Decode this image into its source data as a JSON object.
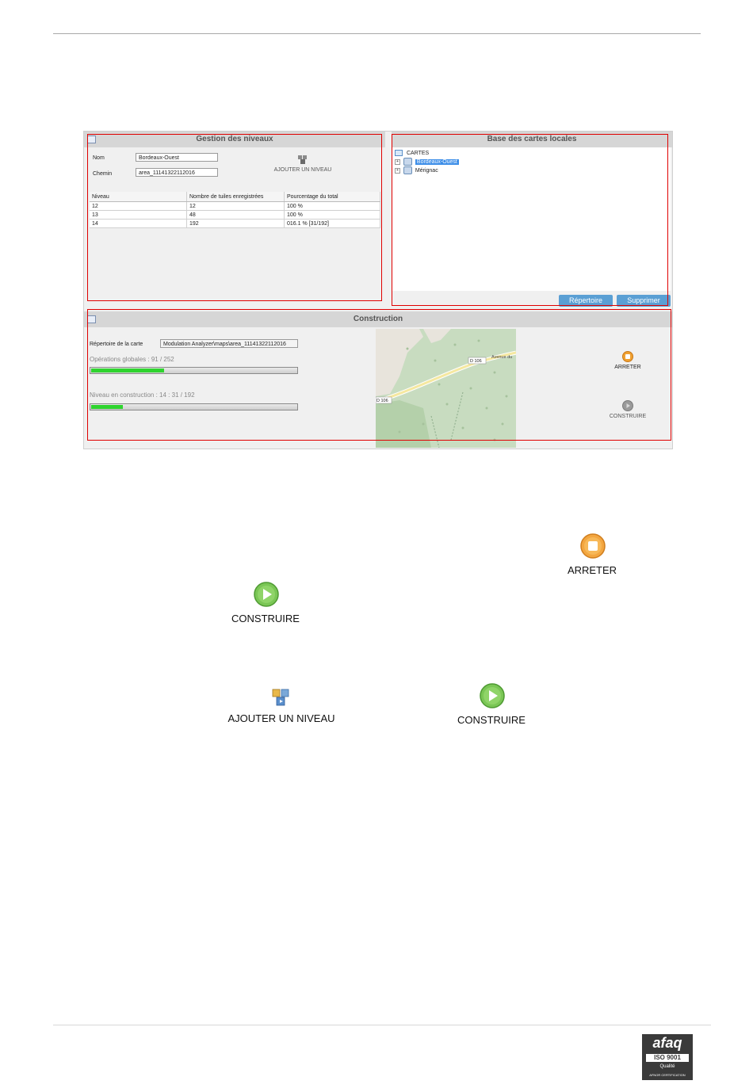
{
  "gestion": {
    "title": "Gestion des niveaux",
    "nom_label": "Nom",
    "nom_value": "Bordeaux-Ouest",
    "chemin_label": "Chemin",
    "chemin_value": "area_11141322112016",
    "add_level_label": "AJOUTER UN NIVEAU",
    "table": {
      "headers": [
        "Niveau",
        "Nombre de tuiles enregistrées",
        "Pourcentage du total"
      ],
      "rows": [
        [
          "12",
          "12",
          "100 %"
        ],
        [
          "13",
          "48",
          "100 %"
        ],
        [
          "14",
          "192",
          "016.1 %  [31/192]"
        ]
      ]
    }
  },
  "base": {
    "title": "Base des cartes locales",
    "root": "CARTES",
    "items": [
      "Bordeaux-Ouest",
      "Mérignac"
    ],
    "repertoire_button": "Répertoire",
    "supprimer_button": "Supprimer"
  },
  "construction": {
    "title": "Construction",
    "repertoire_label": "Répertoire de la carte",
    "repertoire_value": "Modulation Analyzer\\maps\\area_11141322112016",
    "ops_label": "Opérations globales : 91 / 252",
    "ops_progress": 0.361,
    "niveau_label": "Niveau en construction : 14 : 31 / 192",
    "niveau_progress": 0.161,
    "map_labels": [
      "D 106",
      "Avenue du",
      "D 106"
    ],
    "arreter_label": "ARRETER",
    "construire_label": "CONSTRUIRE"
  },
  "icons": {
    "arreter_label": "ARRETER",
    "construire_label_1": "CONSTRUIRE",
    "ajouter_label": "AJOUTER UN NIVEAU",
    "construire_label_2": "CONSTRUIRE"
  },
  "footer": {
    "logo_text": "afaq",
    "iso_text": "ISO 9001",
    "qualite_text": "Qualité",
    "cert_text": "AFNOR CERTIFICATION"
  },
  "colors": {
    "accent_button": "#5a9fd4",
    "progress_green": "#2fd42f",
    "highlight_red": "#e00000",
    "stop_orange": "#f0a030",
    "play_green": "#6cc04a"
  }
}
